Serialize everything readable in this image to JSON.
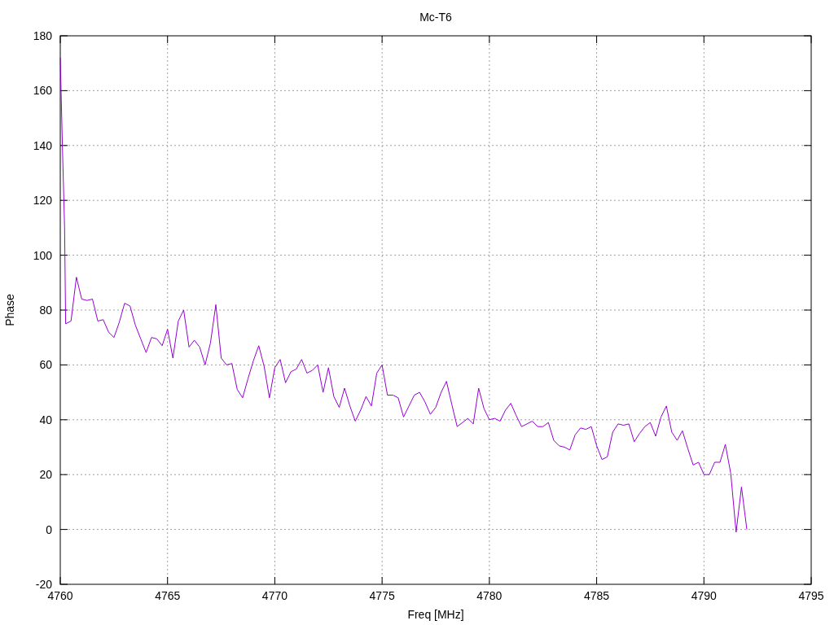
{
  "chart_data": {
    "type": "line",
    "title": "Mc-T6",
    "xlabel": "Freq [MHz]",
    "ylabel": "Phase",
    "grid": true,
    "xlim": [
      4760,
      4795
    ],
    "ylim": [
      -20,
      180
    ],
    "xticks": [
      4760,
      4765,
      4770,
      4775,
      4780,
      4785,
      4790,
      4795
    ],
    "yticks": [
      -20,
      0,
      20,
      40,
      60,
      80,
      100,
      120,
      140,
      160,
      180
    ],
    "x": [
      4760,
      4760.1,
      4760.2,
      4760.25,
      4760.5,
      4760.75,
      4761,
      4761.25,
      4761.5,
      4761.75,
      4762,
      4762.25,
      4762.5,
      4762.75,
      4763,
      4763.25,
      4763.5,
      4763.75,
      4764,
      4764.25,
      4764.5,
      4764.75,
      4765,
      4765.25,
      4765.5,
      4765.75,
      4766,
      4766.25,
      4766.5,
      4766.75,
      4767,
      4767.25,
      4767.5,
      4767.75,
      4768,
      4768.25,
      4768.5,
      4768.75,
      4769,
      4769.25,
      4769.5,
      4769.75,
      4770,
      4770.25,
      4770.5,
      4770.75,
      4771,
      4771.25,
      4771.5,
      4771.75,
      4772,
      4772.25,
      4772.5,
      4772.75,
      4773,
      4773.25,
      4773.5,
      4773.75,
      4774,
      4774.25,
      4774.5,
      4774.75,
      4775,
      4775.25,
      4775.5,
      4775.75,
      4776,
      4776.25,
      4776.5,
      4776.75,
      4777,
      4777.25,
      4777.5,
      4777.75,
      4778,
      4778.25,
      4778.5,
      4778.75,
      4779,
      4779.25,
      4779.5,
      4779.75,
      4780,
      4780.25,
      4780.5,
      4780.75,
      4781,
      4781.25,
      4781.5,
      4781.75,
      4782,
      4782.25,
      4782.5,
      4782.75,
      4783,
      4783.25,
      4783.5,
      4783.75,
      4784,
      4784.25,
      4784.5,
      4784.75,
      4785,
      4785.25,
      4785.5,
      4785.75,
      4786,
      4786.25,
      4786.5,
      4786.75,
      4787,
      4787.25,
      4787.5,
      4787.75,
      4788,
      4788.25,
      4788.5,
      4788.75,
      4789,
      4789.25,
      4789.5,
      4789.75,
      4790,
      4790.25,
      4790.5,
      4790.75,
      4791,
      4791.25,
      4791.5,
      4791.75,
      4792
    ],
    "series": [
      {
        "color": "#9400d3",
        "values": [
          172,
          140,
          110,
          75,
          76,
          92,
          84,
          83.5,
          84,
          76,
          76.5,
          72,
          70,
          75.5,
          82.5,
          81.5,
          74.5,
          69.5,
          64.5,
          70,
          69.5,
          67,
          73,
          62.5,
          76,
          80,
          66.5,
          69,
          66.5,
          60,
          68,
          82,
          62.5,
          60,
          60.5,
          51,
          48,
          55,
          61.5,
          67,
          59.5,
          48,
          59,
          62,
          53.5,
          57.5,
          58.5,
          62,
          57,
          58,
          60,
          50,
          59,
          48.5,
          44.5,
          51.5,
          45,
          39.5,
          43.5,
          48.5,
          45,
          57,
          60,
          49,
          49,
          48,
          41,
          45,
          49,
          50,
          46.5,
          42,
          44.5,
          50,
          54,
          45.5,
          37.5,
          39,
          40.5,
          38.5,
          51.5,
          44,
          40,
          40.5,
          39.5,
          43.5,
          46,
          41.5,
          37.5,
          38.5,
          39.5,
          37.5,
          37.5,
          39,
          32.5,
          30.5,
          30,
          29,
          34.5,
          37,
          36.5,
          37.5,
          30.5,
          25.5,
          26.5,
          35.5,
          38.5,
          38,
          38.5,
          32,
          35,
          37.5,
          39,
          34,
          41,
          45,
          35.5,
          32.5,
          36,
          29.5,
          23.5,
          24.5,
          20,
          20,
          24.5,
          24.5,
          31,
          20.5,
          -1,
          15.5,
          0
        ]
      }
    ]
  }
}
